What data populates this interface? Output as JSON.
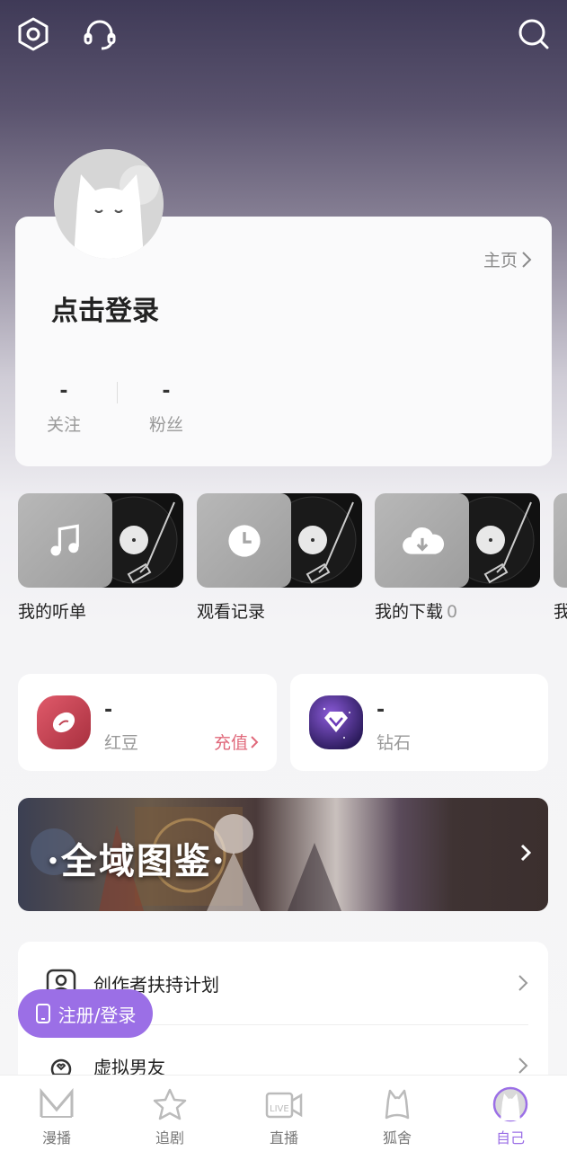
{
  "top_bar": {
    "settings_icon": "settings-hex-icon",
    "support_icon": "headset-icon",
    "search_icon": "search-icon"
  },
  "profile": {
    "home_link": "主页",
    "login_prompt": "点击登录",
    "stats": [
      {
        "value": "-",
        "label": "关注"
      },
      {
        "value": "-",
        "label": "粉丝"
      }
    ]
  },
  "quick_links": [
    {
      "label": "我的听单",
      "icon": "music-note-icon",
      "count": ""
    },
    {
      "label": "观看记录",
      "icon": "clock-icon",
      "count": ""
    },
    {
      "label": "我的下载",
      "icon": "cloud-download-icon",
      "count": "0"
    },
    {
      "label": "我",
      "icon": "partial-item",
      "count": ""
    }
  ],
  "wallet": {
    "bean": {
      "value": "-",
      "label": "红豆",
      "action": "充值"
    },
    "diamond": {
      "value": "-",
      "label": "钻石"
    }
  },
  "banner": {
    "title": "·全域图鉴·"
  },
  "menu": [
    {
      "label": "创作者扶持计划",
      "icon": "creator-icon"
    },
    {
      "label": "虚拟男友",
      "icon": "chat-heart-icon"
    }
  ],
  "register_button": "注册/登录",
  "tabs": [
    {
      "label": "漫播",
      "icon": "m-logo-icon",
      "active": false
    },
    {
      "label": "追剧",
      "icon": "star-icon",
      "active": false
    },
    {
      "label": "直播",
      "icon": "live-icon",
      "active": false
    },
    {
      "label": "狐舍",
      "icon": "fox-icon",
      "active": false
    },
    {
      "label": "自己",
      "icon": "avatar-icon",
      "active": true
    }
  ],
  "colors": {
    "accent": "#9b6fe6",
    "recharge": "#e0687a"
  }
}
